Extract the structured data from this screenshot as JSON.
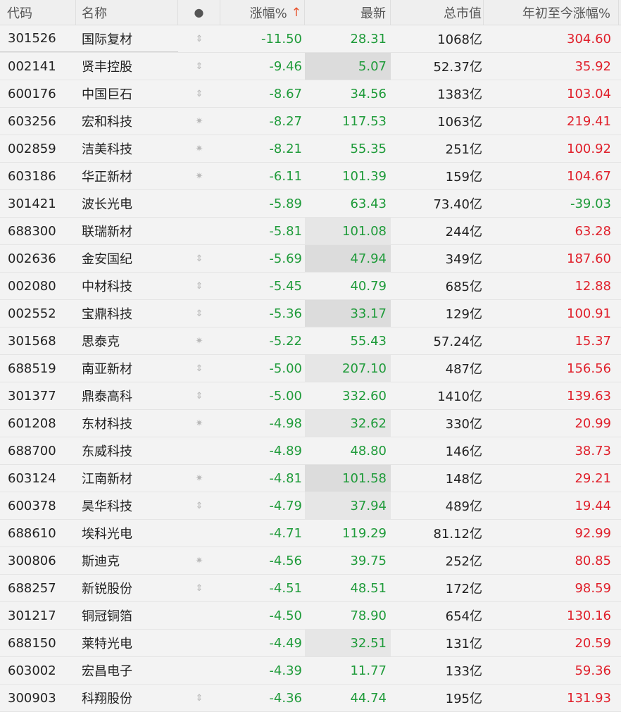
{
  "columns": {
    "code": "代码",
    "name": "名称",
    "mark": "●",
    "change": "涨幅%",
    "change_sort": "↑",
    "last": "最新",
    "market_cap": "总市值",
    "ytd": "年初至今涨幅%"
  },
  "colors": {
    "down": "#1f9b3a",
    "up": "#e0202b",
    "sort": "#e8502a"
  },
  "rows": [
    {
      "code": "301526",
      "name": "国际复材",
      "mark": "⇕",
      "change": "-11.50",
      "last": "28.31",
      "cap": "1068亿",
      "ytd": "304.60"
    },
    {
      "code": "002141",
      "name": "贤丰控股",
      "mark": "⇕",
      "change": "-9.46",
      "last": "5.07",
      "cap": "52.37亿",
      "ytd": "35.92"
    },
    {
      "code": "600176",
      "name": "中国巨石",
      "mark": "⇕",
      "change": "-8.67",
      "last": "34.56",
      "cap": "1383亿",
      "ytd": "103.04"
    },
    {
      "code": "603256",
      "name": "宏和科技",
      "mark": "✷",
      "change": "-8.27",
      "last": "117.53",
      "cap": "1063亿",
      "ytd": "219.41"
    },
    {
      "code": "002859",
      "name": "洁美科技",
      "mark": "✷",
      "change": "-8.21",
      "last": "55.35",
      "cap": "251亿",
      "ytd": "100.92"
    },
    {
      "code": "603186",
      "name": "华正新材",
      "mark": "✷",
      "change": "-6.11",
      "last": "101.39",
      "cap": "159亿",
      "ytd": "104.67"
    },
    {
      "code": "301421",
      "name": "波长光电",
      "mark": "",
      "change": "-5.89",
      "last": "63.43",
      "cap": "73.40亿",
      "ytd": "-39.03"
    },
    {
      "code": "688300",
      "name": "联瑞新材",
      "mark": "",
      "change": "-5.81",
      "last": "101.08",
      "cap": "244亿",
      "ytd": "63.28"
    },
    {
      "code": "002636",
      "name": "金安国纪",
      "mark": "⇕",
      "change": "-5.69",
      "last": "47.94",
      "cap": "349亿",
      "ytd": "187.60"
    },
    {
      "code": "002080",
      "name": "中材科技",
      "mark": "⇕",
      "change": "-5.45",
      "last": "40.79",
      "cap": "685亿",
      "ytd": "12.88"
    },
    {
      "code": "002552",
      "name": "宝鼎科技",
      "mark": "⇕",
      "change": "-5.36",
      "last": "33.17",
      "cap": "129亿",
      "ytd": "100.91"
    },
    {
      "code": "301568",
      "name": "思泰克",
      "mark": "✷",
      "change": "-5.22",
      "last": "55.43",
      "cap": "57.24亿",
      "ytd": "15.37"
    },
    {
      "code": "688519",
      "name": "南亚新材",
      "mark": "⇕",
      "change": "-5.00",
      "last": "207.10",
      "cap": "487亿",
      "ytd": "156.56"
    },
    {
      "code": "301377",
      "name": "鼎泰高科",
      "mark": "⇕",
      "change": "-5.00",
      "last": "332.60",
      "cap": "1410亿",
      "ytd": "139.63"
    },
    {
      "code": "601208",
      "name": "东材科技",
      "mark": "✷",
      "change": "-4.98",
      "last": "32.62",
      "cap": "330亿",
      "ytd": "20.99"
    },
    {
      "code": "688700",
      "name": "东威科技",
      "mark": "",
      "change": "-4.89",
      "last": "48.80",
      "cap": "146亿",
      "ytd": "38.73"
    },
    {
      "code": "603124",
      "name": "江南新材",
      "mark": "✷",
      "change": "-4.81",
      "last": "101.58",
      "cap": "148亿",
      "ytd": "29.21"
    },
    {
      "code": "600378",
      "name": "昊华科技",
      "mark": "⇕",
      "change": "-4.79",
      "last": "37.94",
      "cap": "489亿",
      "ytd": "19.44"
    },
    {
      "code": "688610",
      "name": "埃科光电",
      "mark": "",
      "change": "-4.71",
      "last": "119.29",
      "cap": "81.12亿",
      "ytd": "92.99"
    },
    {
      "code": "300806",
      "name": "斯迪克",
      "mark": "✷",
      "change": "-4.56",
      "last": "39.75",
      "cap": "252亿",
      "ytd": "80.85"
    },
    {
      "code": "688257",
      "name": "新锐股份",
      "mark": "⇕",
      "change": "-4.51",
      "last": "48.51",
      "cap": "172亿",
      "ytd": "98.59"
    },
    {
      "code": "301217",
      "name": "铜冠铜箔",
      "mark": "",
      "change": "-4.50",
      "last": "78.90",
      "cap": "654亿",
      "ytd": "130.16"
    },
    {
      "code": "688150",
      "name": "莱特光电",
      "mark": "",
      "change": "-4.49",
      "last": "32.51",
      "cap": "131亿",
      "ytd": "20.59"
    },
    {
      "code": "603002",
      "name": "宏昌电子",
      "mark": "",
      "change": "-4.39",
      "last": "11.77",
      "cap": "133亿",
      "ytd": "59.36"
    },
    {
      "code": "300903",
      "name": "科翔股份",
      "mark": "⇕",
      "change": "-4.36",
      "last": "44.74",
      "cap": "195亿",
      "ytd": "131.93"
    }
  ]
}
